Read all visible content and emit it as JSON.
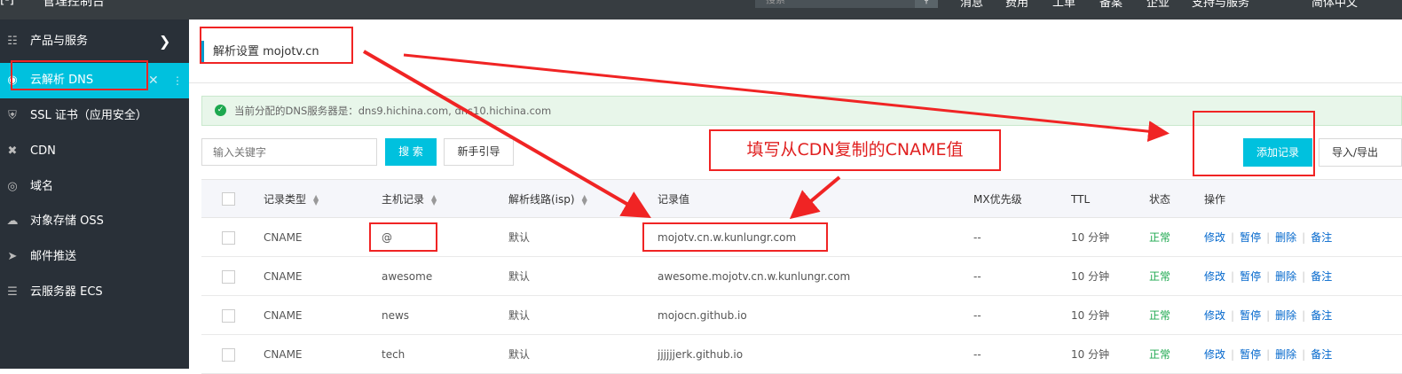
{
  "topbar": {
    "title": "管理控制台",
    "search_placeholder": "搜索",
    "nav": [
      "消息",
      "费用",
      "工单",
      "备案",
      "企业",
      "支持与服务",
      "简体中文"
    ]
  },
  "sidebar": {
    "items": [
      {
        "icon": "grid-icon",
        "label": "产品与服务"
      },
      {
        "icon": "dns-icon",
        "label": "云解析 DNS"
      },
      {
        "icon": "shield-icon",
        "label": "SSL 证书（应用安全）"
      },
      {
        "icon": "cdn-icon",
        "label": "CDN"
      },
      {
        "icon": "globe-icon",
        "label": "域名"
      },
      {
        "icon": "cloud-icon",
        "label": "对象存储 OSS"
      },
      {
        "icon": "mail-icon",
        "label": "邮件推送"
      },
      {
        "icon": "server-icon",
        "label": "云服务器 ECS"
      }
    ]
  },
  "main": {
    "page_title": "解析设置 mojotv.cn",
    "notice": "当前分配的DNS服务器是：dns9.hichina.com, dns10.hichina.com",
    "search_placeholder": "输入关键字",
    "search_button": "搜 索",
    "guide_button": "新手引导",
    "add_button": "添加记录",
    "io_button": "导入/导出",
    "columns": [
      "记录类型",
      "主机记录",
      "解析线路(isp)",
      "记录值",
      "MX优先级",
      "TTL",
      "状态",
      "操作"
    ],
    "rows": [
      {
        "type": "CNAME",
        "host": "@",
        "line": "默认",
        "value": "mojotv.cn.w.kunlungr.com",
        "mx": "--",
        "ttl": "10 分钟",
        "status": "正常"
      },
      {
        "type": "CNAME",
        "host": "awesome",
        "line": "默认",
        "value": "awesome.mojotv.cn.w.kunlungr.com",
        "mx": "--",
        "ttl": "10 分钟",
        "status": "正常"
      },
      {
        "type": "CNAME",
        "host": "news",
        "line": "默认",
        "value": "mojocn.github.io",
        "mx": "--",
        "ttl": "10 分钟",
        "status": "正常"
      },
      {
        "type": "CNAME",
        "host": "tech",
        "line": "默认",
        "value": "jjjjjjerk.github.io",
        "mx": "--",
        "ttl": "10 分钟",
        "status": "正常"
      }
    ],
    "actions": [
      "修改",
      "暂停",
      "删除",
      "备注"
    ]
  },
  "annotation": {
    "callout": "填写从CDN复制的CNAME值",
    "color": "#f02424"
  },
  "colors": {
    "accent": "#00c1de",
    "sidebar": "#293038",
    "topbar": "#373d41",
    "ok": "#1da84f",
    "link": "#0066cc"
  }
}
